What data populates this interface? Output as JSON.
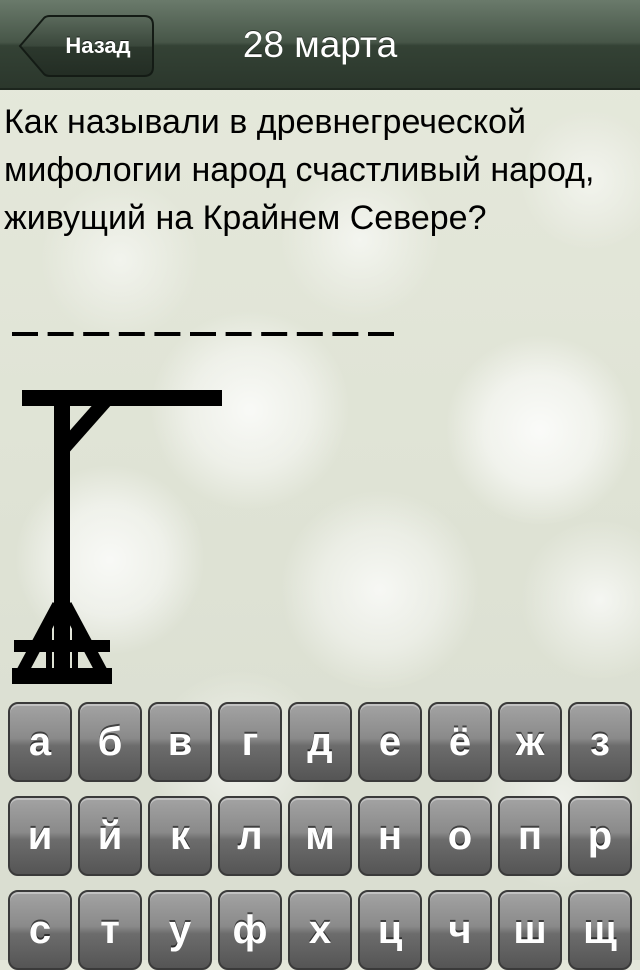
{
  "navbar": {
    "back_label": "Назад",
    "title": "28 марта"
  },
  "question": {
    "text": "Как называли в древнегреческой мифологии народ счастливый народ, живущий на Крайнем Севере?"
  },
  "word": {
    "length": 11,
    "revealed": [
      "",
      "",
      "",
      "",
      "",
      "",
      "",
      "",
      "",
      "",
      ""
    ]
  },
  "gallows": {
    "wrong_guesses_shown": "base, post, beam, brace"
  },
  "keyboard": {
    "rows": [
      [
        "а",
        "б",
        "в",
        "г",
        "д",
        "е",
        "ё",
        "ж",
        "з"
      ],
      [
        "и",
        "й",
        "к",
        "л",
        "м",
        "н",
        "о",
        "п",
        "р"
      ],
      [
        "с",
        "т",
        "у",
        "ф",
        "х",
        "ц",
        "ч",
        "ш",
        "щ"
      ]
    ]
  },
  "colors": {
    "navbar": "#3f4d40",
    "key": "#7a7a7a",
    "ink": "#000000"
  }
}
